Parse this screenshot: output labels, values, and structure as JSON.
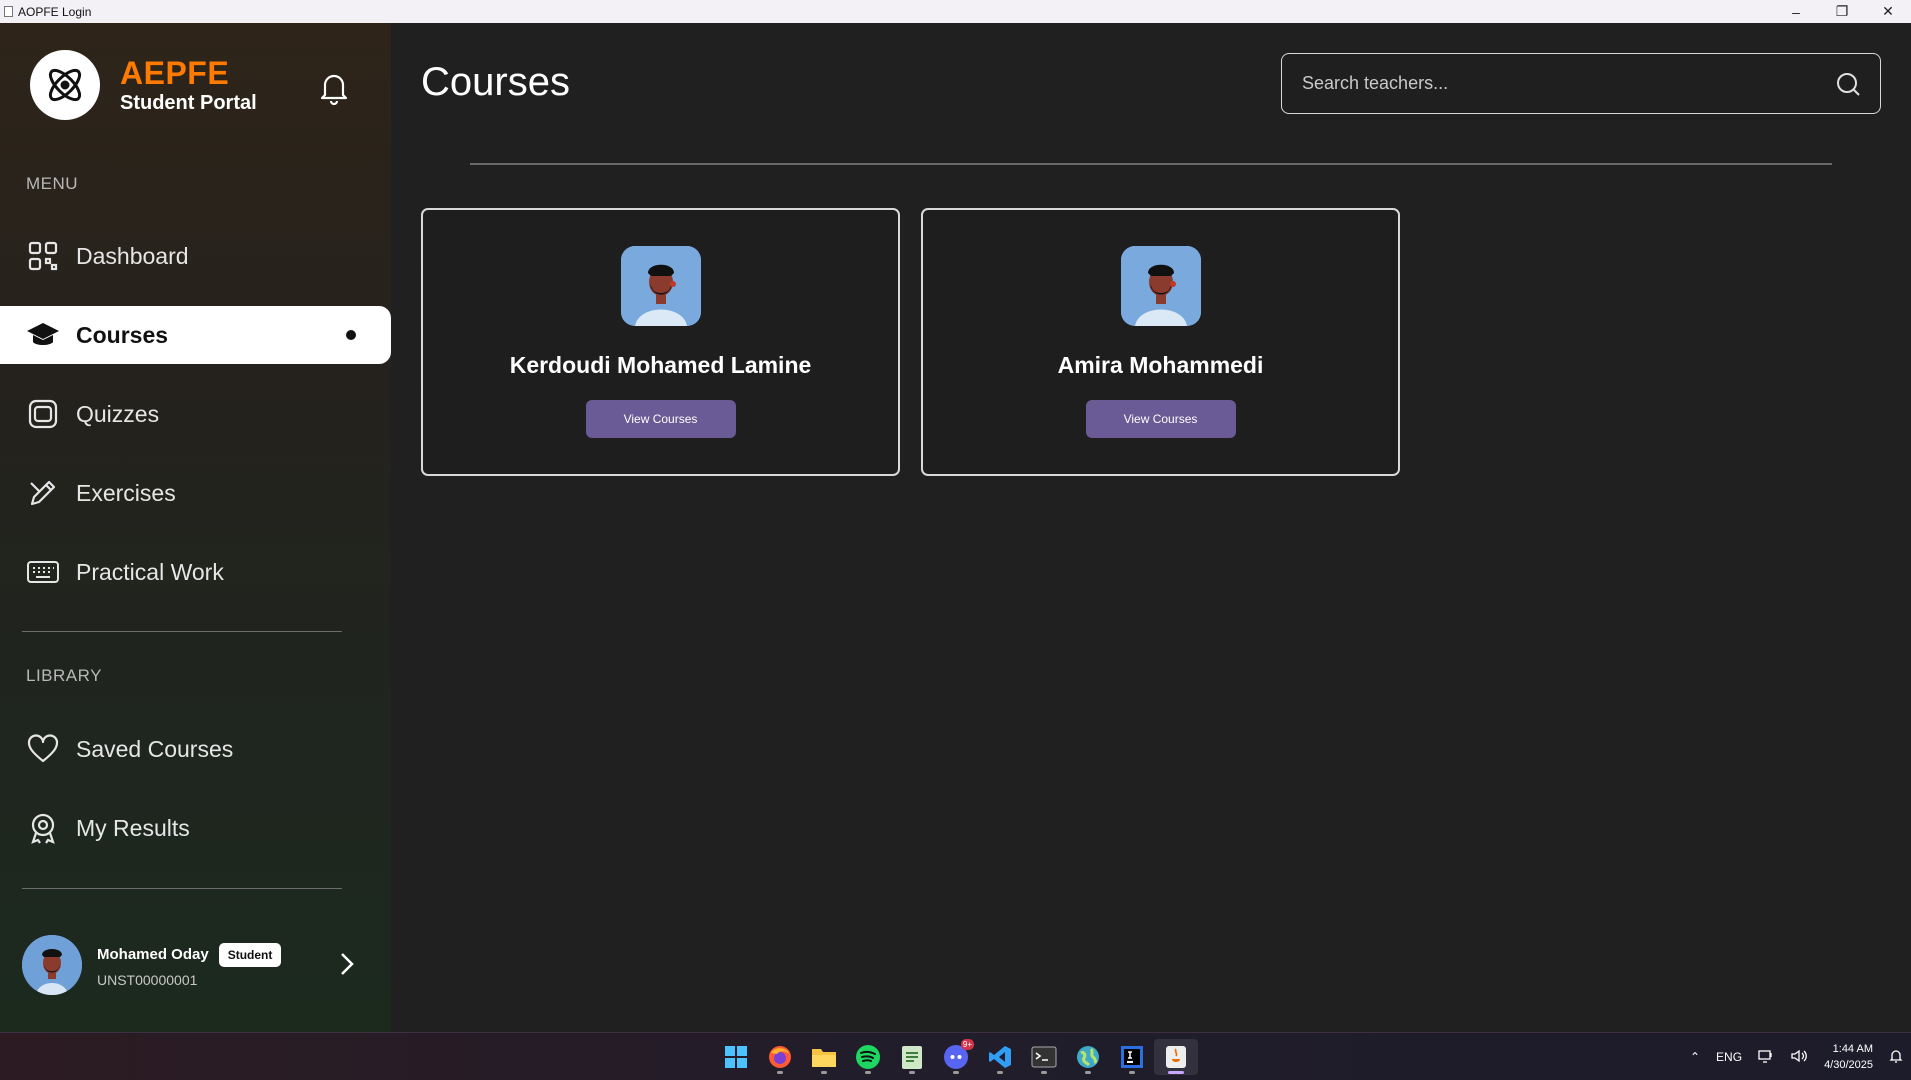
{
  "window": {
    "title": "AOPFE Login"
  },
  "sidebar": {
    "brand_name": "AEPFE",
    "brand_sub": "Student Portal",
    "menu_label": "MENU",
    "menu": [
      {
        "label": "Dashboard",
        "icon": "grid-icon"
      },
      {
        "label": "Courses",
        "icon": "graduation-cap-icon",
        "active": true
      },
      {
        "label": "Quizzes",
        "icon": "quiz-icon"
      },
      {
        "label": "Exercises",
        "icon": "pencil-icon"
      },
      {
        "label": "Practical Work",
        "icon": "keyboard-icon"
      }
    ],
    "library_label": "LIBRARY",
    "library": [
      {
        "label": "Saved Courses",
        "icon": "heart-icon"
      },
      {
        "label": "My Results",
        "icon": "award-icon"
      }
    ],
    "user": {
      "name": "Mohamed Oday",
      "role": "Student",
      "id": "UNST00000001"
    }
  },
  "main": {
    "title": "Courses",
    "search_placeholder": "Search teachers...",
    "teachers": [
      {
        "name": "Kerdoudi Mohamed Lamine",
        "button": "View Courses"
      },
      {
        "name": "Amira Mohammedi",
        "button": "View Courses"
      }
    ]
  },
  "taskbar": {
    "apps": [
      "windows-start-icon",
      "firefox-icon",
      "file-explorer-icon",
      "spotify-icon",
      "notepad-icon",
      "discord-icon",
      "vscode-icon",
      "terminal-icon",
      "globe-icon",
      "intellij-icon",
      "java-icon"
    ],
    "discord_badge": "9+",
    "language": "ENG",
    "time": "1:44 AM",
    "date": "4/30/2025"
  },
  "colors": {
    "accent": "#ff7a00",
    "button": "#6a5a95",
    "active_bg": "#ffffff"
  }
}
